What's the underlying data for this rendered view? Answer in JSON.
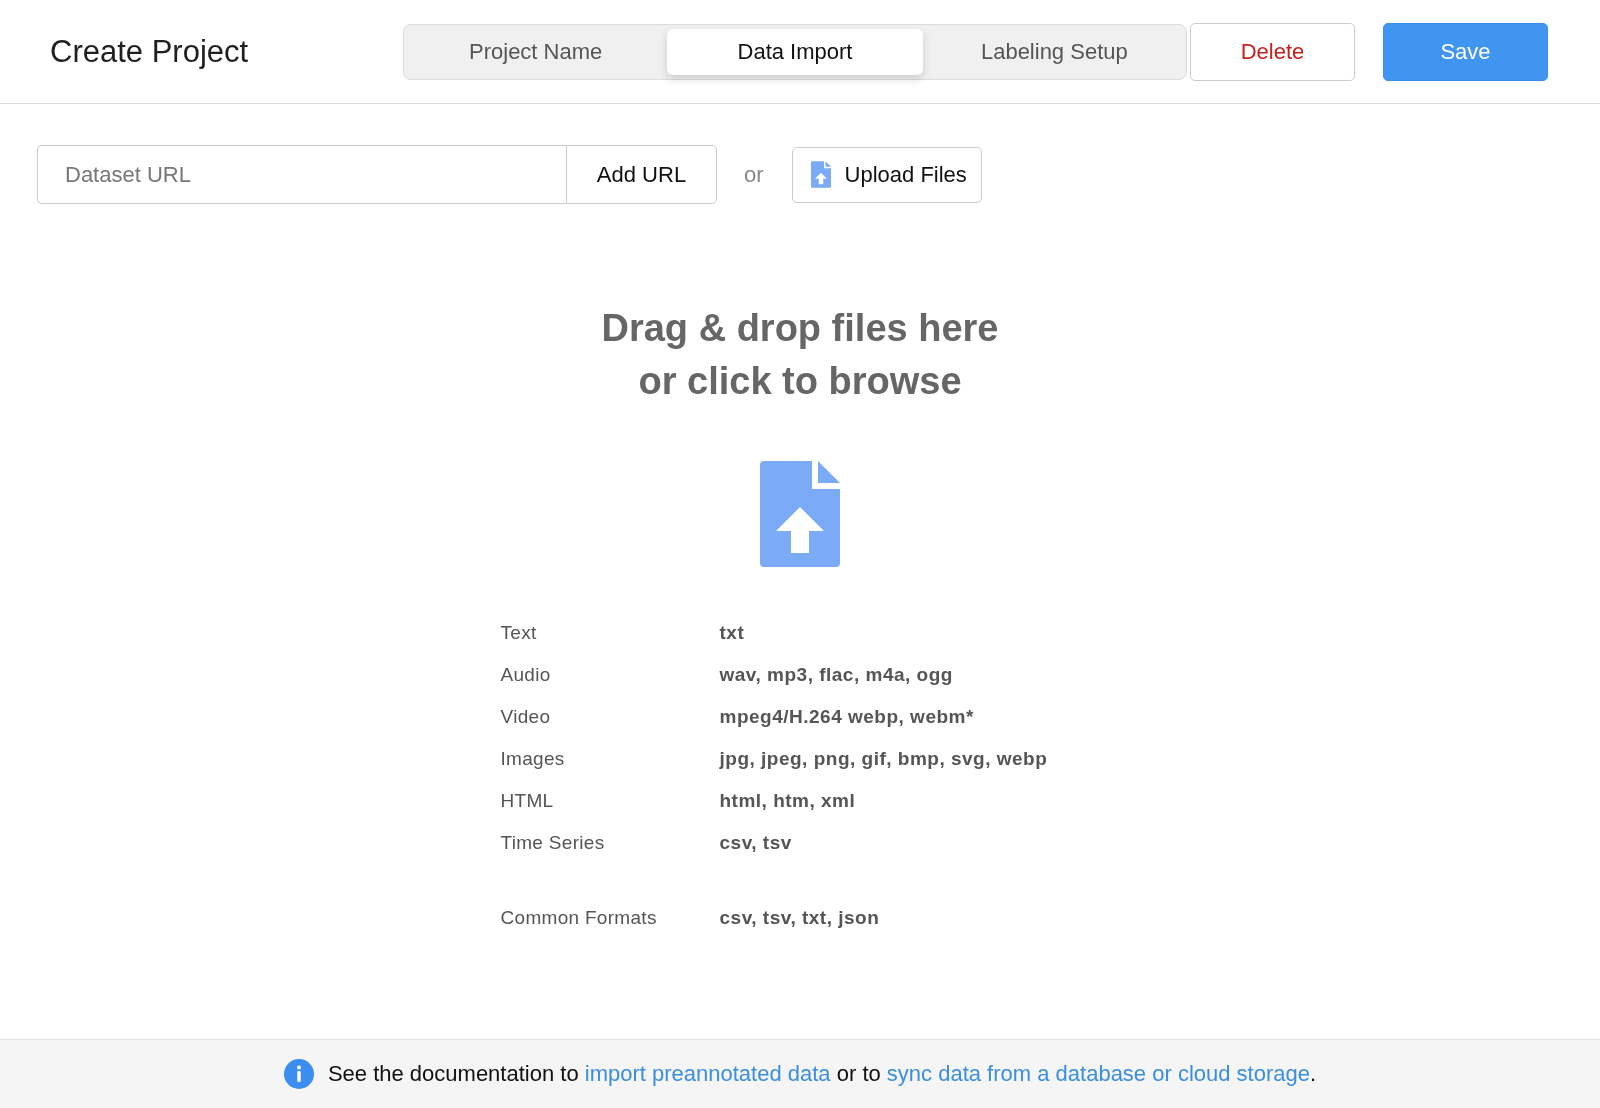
{
  "header": {
    "title": "Create Project",
    "tabs": [
      {
        "label": "Project Name",
        "selected": false
      },
      {
        "label": "Data Import",
        "selected": true
      },
      {
        "label": "Labeling Setup",
        "selected": false
      }
    ],
    "buttons": [
      {
        "label": "Delete",
        "kind": "danger"
      },
      {
        "label": "Save",
        "kind": "primary"
      }
    ]
  },
  "import_bar": {
    "url_field": {
      "placeholder": "Dataset URL"
    },
    "add_button": "Add URL",
    "separator": "or",
    "upload_button": "Upload Files"
  },
  "dropzone": {
    "heading_lines": [
      "Drag & drop files here",
      "or click to browse"
    ],
    "formats": [
      {
        "type": "Text",
        "extensions": "txt"
      },
      {
        "type": "Audio",
        "extensions": "wav, mp3, flac, m4a, ogg"
      },
      {
        "type": "Video",
        "extensions": "mpeg4/H.264 webp, webm*"
      },
      {
        "type": "Images",
        "extensions": "jpg, jpeg, png, gif, bmp, svg, webp"
      },
      {
        "type": "HTML",
        "extensions": "html, htm, xml"
      },
      {
        "type": "Time Series",
        "extensions": "csv, tsv"
      },
      {
        "type": "Common Formats",
        "extensions": "csv, tsv, txt, json",
        "separated": true
      }
    ]
  },
  "footer": {
    "parts": [
      {
        "kind": "text",
        "text": "See the documentation to "
      },
      {
        "kind": "link",
        "text": "import preannotated data"
      },
      {
        "kind": "text",
        "text": " or to "
      },
      {
        "kind": "link",
        "text": "sync data from a database or cloud storage"
      },
      {
        "kind": "text",
        "text": "."
      }
    ]
  }
}
